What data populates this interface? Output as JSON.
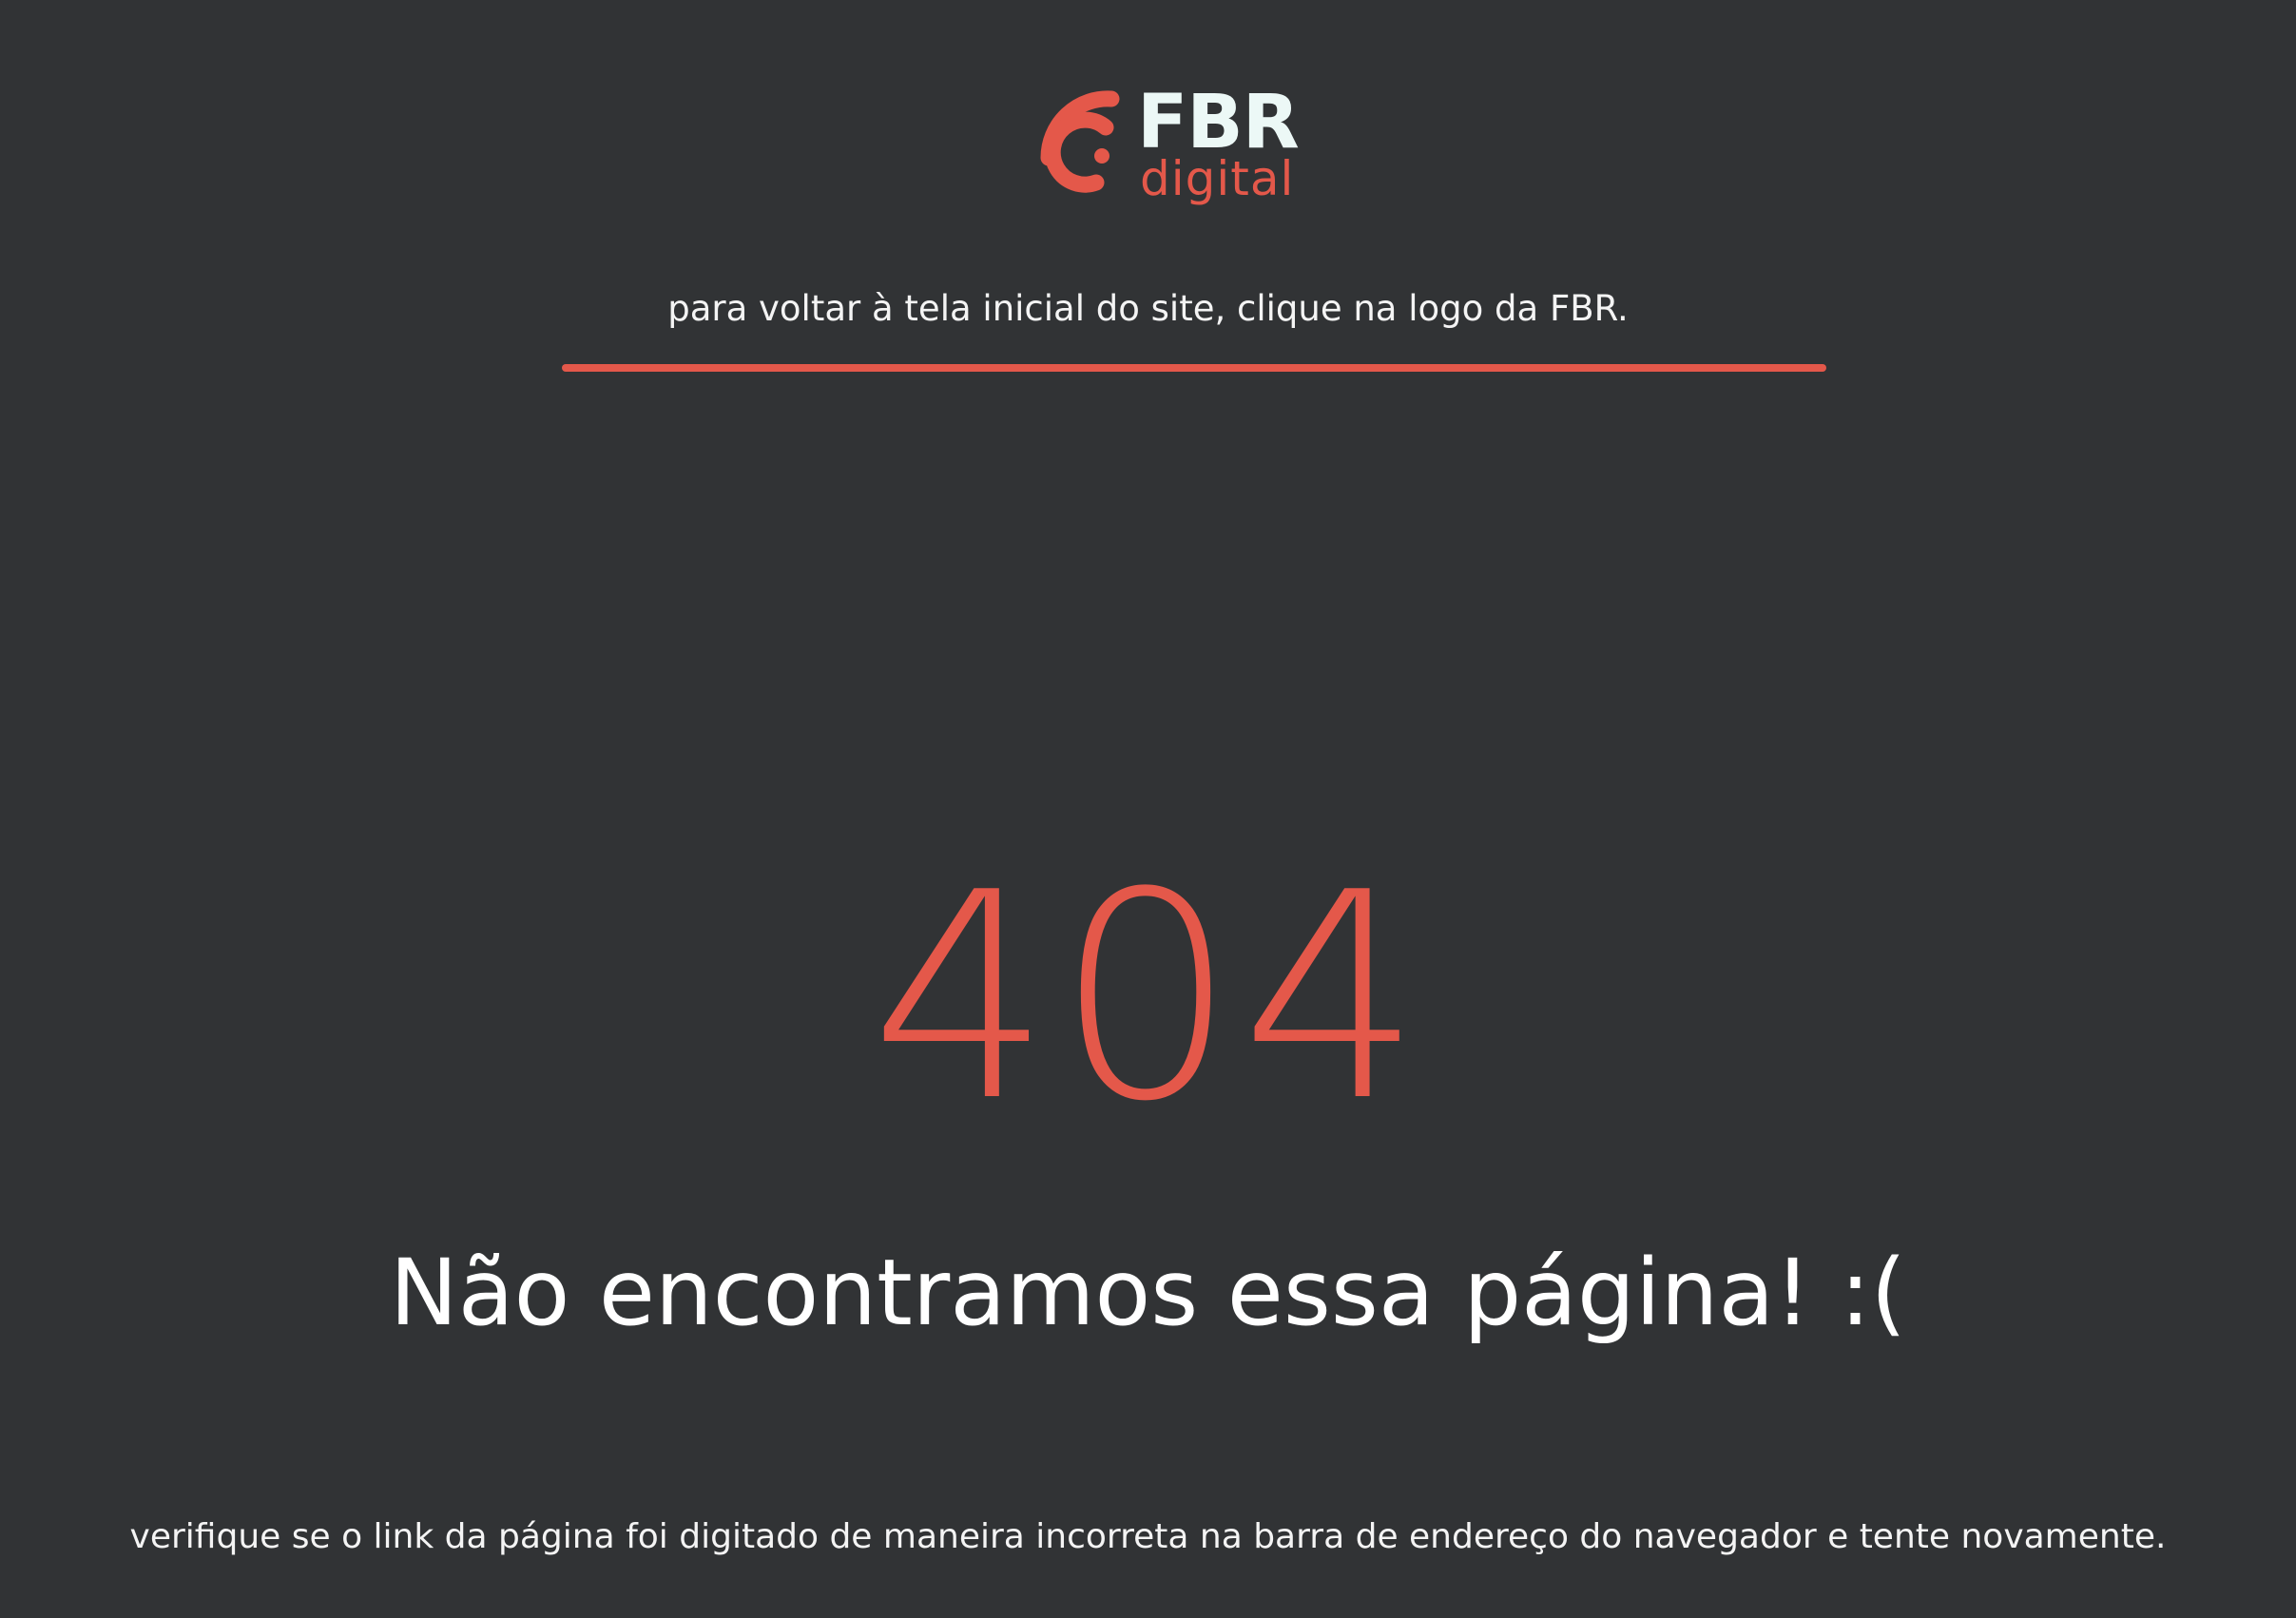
{
  "logo": {
    "icon": "fbr-signal-icon",
    "brand": "FBR",
    "sub": "digital"
  },
  "hint_text": "para voltar à tela inicial do site, clique na logo da FBR.",
  "error_code": "404",
  "heading": "Não encontramos essa página! :(",
  "note_text": "verifique se o link da página foi digitado de maneira incorreta na barra de endereço do navegador e tente novamente.",
  "colors": {
    "background": "#313335",
    "accent": "#e4584a",
    "text": "#ffffff",
    "logo_text": "#ecf8f6"
  }
}
